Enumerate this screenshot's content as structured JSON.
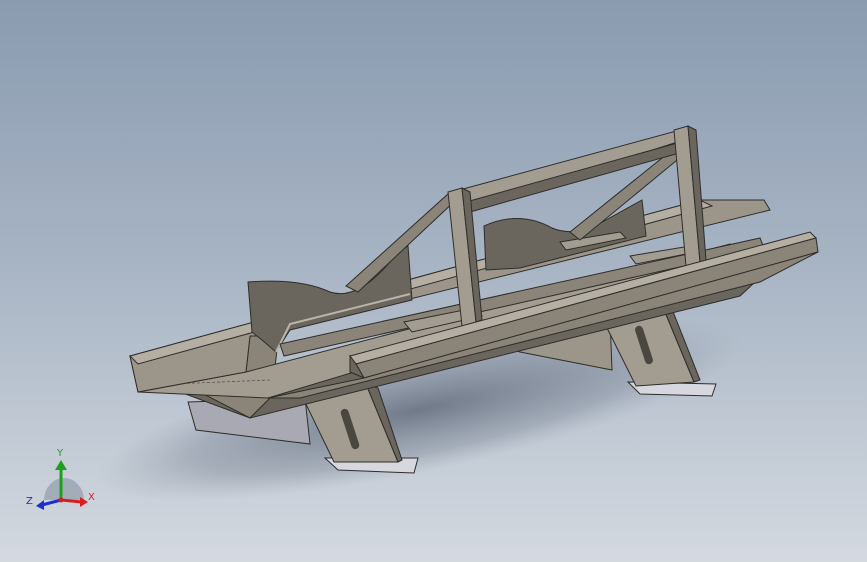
{
  "triad": {
    "x_label": "X",
    "y_label": "Y",
    "z_label": "Z",
    "x_color": "#d62020",
    "y_color": "#1ea01e",
    "z_color": "#1c2fd0"
  },
  "colors": {
    "steel_light": "#a29c91",
    "steel_mid": "#8a8479",
    "steel_dark": "#6b665d",
    "steel_shadow": "#55514a",
    "edge": "#2f2d2a",
    "foot_plate": "#d7d8df",
    "shadow": "#7d8698"
  }
}
